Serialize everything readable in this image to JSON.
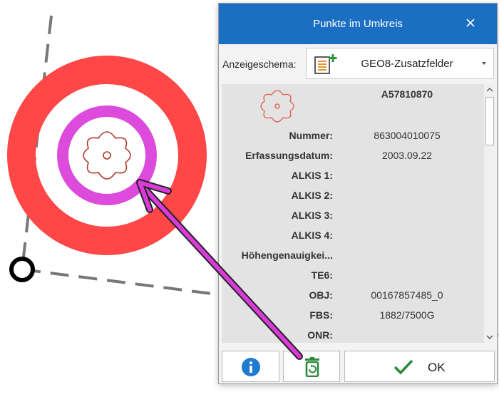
{
  "dialog": {
    "title": "Punkte im Umkreis",
    "schema_label": "Anzeigeschema:",
    "schema_value": "GEO8-Zusatzfelder",
    "record_id": "A57810870",
    "fields": [
      {
        "label": "Nummer:",
        "value": "863004010075"
      },
      {
        "label": "Erfassungsdatum:",
        "value": "2003.09.22"
      },
      {
        "label": "ALKIS 1:",
        "value": ""
      },
      {
        "label": "ALKIS 2:",
        "value": ""
      },
      {
        "label": "ALKIS 3:",
        "value": ""
      },
      {
        "label": "ALKIS 4:",
        "value": ""
      },
      {
        "label": "Höhengenauigkei...",
        "value": ""
      },
      {
        "label": "TE6:",
        "value": ""
      },
      {
        "label": "OBJ:",
        "value": "00167857485_0"
      },
      {
        "label": "FBS:",
        "value": "1882/7500G"
      },
      {
        "label": "ONR:",
        "value": ""
      }
    ],
    "ok_label": "OK",
    "colors": {
      "titlebar": "#1a6fc2",
      "info_icon": "#1e7bd0",
      "delete_icon": "#2a8a3c",
      "ok_check": "#2a8a3c"
    }
  },
  "map": {
    "colors": {
      "outer_ring": "#ff4747",
      "inner_ring": "#dc4bdc",
      "symbol": "#b03a2e",
      "arrow": "#d93bd9",
      "dashed_line": "#777777"
    }
  }
}
